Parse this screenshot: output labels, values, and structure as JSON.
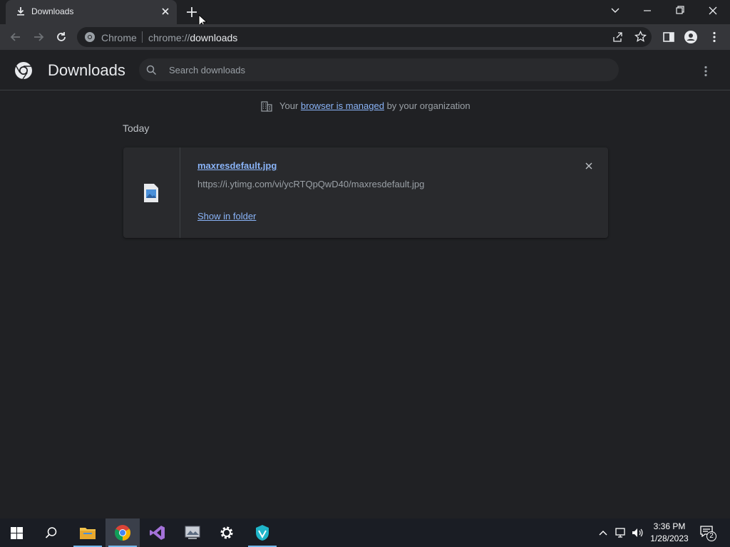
{
  "browser": {
    "tab_title": "Downloads",
    "omnibox_site": "Chrome",
    "url_prefix": "chrome://",
    "url_path": "downloads"
  },
  "downloads_page": {
    "title": "Downloads",
    "search_placeholder": "Search downloads",
    "managed_prefix": "Your ",
    "managed_link": "browser is managed",
    "managed_suffix": " by your organization",
    "group_label": "Today",
    "items": [
      {
        "filename": "maxresdefault.jpg",
        "url": "https://i.ytimg.com/vi/ycRTQpQwD40/maxresdefault.jpg",
        "action_label": "Show in folder"
      }
    ]
  },
  "taskbar": {
    "time": "3:36 PM",
    "date": "1/28/2023",
    "notification_count": "2"
  },
  "colors": {
    "background": "#202124",
    "link": "#8ab4f8",
    "taskbar": "#1a1d24"
  }
}
